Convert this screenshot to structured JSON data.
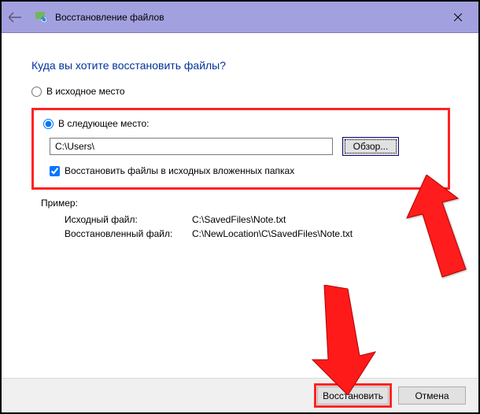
{
  "window": {
    "title": "Восстановление файлов"
  },
  "heading": "Куда вы хотите восстановить файлы?",
  "radio_original": {
    "label": "В исходное место"
  },
  "radio_custom": {
    "label": "В следующее место:"
  },
  "path_value": "C:\\Users\\",
  "browse_label": "Обзор...",
  "checkbox_label": "Восстановить файлы в исходных вложенных папках",
  "example": {
    "header": "Пример:",
    "src_label": "Исходный файл:",
    "src_value": "C:\\SavedFiles\\Note.txt",
    "dst_label": "Восстановленный файл:",
    "dst_value": "C:\\NewLocation\\C\\SavedFiles\\Note.txt"
  },
  "footer": {
    "restore": "Восстановить",
    "cancel": "Отмена"
  }
}
